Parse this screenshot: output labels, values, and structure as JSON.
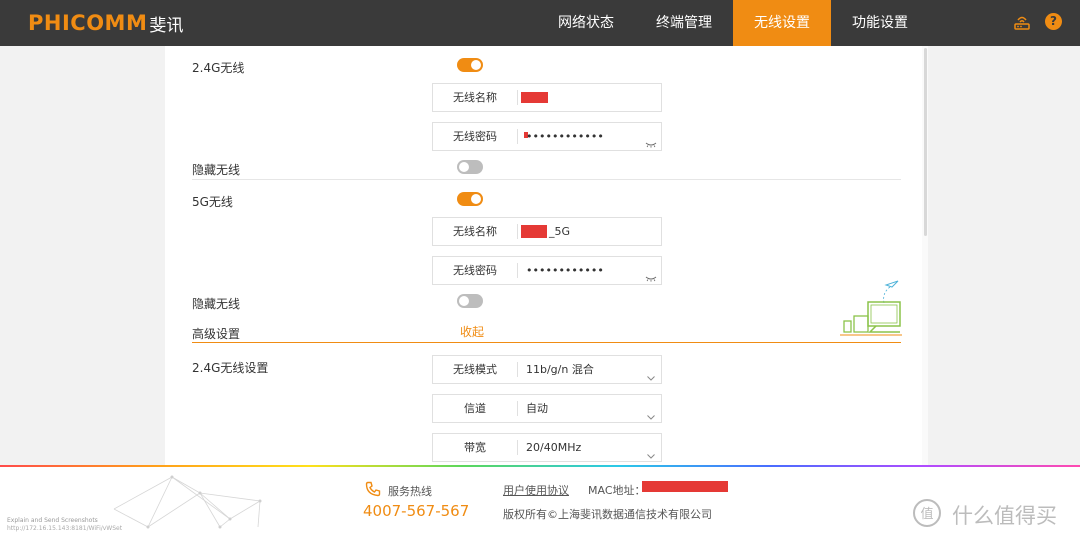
{
  "header": {
    "brand": "PHICOMM",
    "brand_cn": "斐讯",
    "nav": [
      {
        "label": "网络状态",
        "active": false
      },
      {
        "label": "终端管理",
        "active": false
      },
      {
        "label": "无线设置",
        "active": true
      },
      {
        "label": "功能设置",
        "active": false
      }
    ],
    "icons": [
      "router-icon",
      "help-icon"
    ],
    "help_glyph": "?"
  },
  "wireless_24g": {
    "label": "2.4G无线",
    "enabled": true,
    "ssid_label": "无线名称",
    "ssid_value": "",
    "password_label": "无线密码",
    "password_value": "••••••••••••",
    "hide_label": "隐藏无线",
    "hidden": false
  },
  "wireless_5g": {
    "label": "5G无线",
    "enabled": true,
    "ssid_label": "无线名称",
    "ssid_value": "_5G",
    "password_label": "无线密码",
    "password_value": "••••••••••••",
    "hide_label": "隐藏无线",
    "hidden": false
  },
  "advanced": {
    "label": "高级设置",
    "collapse_label": "收起",
    "section_24g_label": "2.4G无线设置",
    "mode_label": "无线模式",
    "mode_value": "11b/g/n 混合",
    "channel_label": "信道",
    "channel_value": "自动",
    "bandwidth_label": "带宽",
    "bandwidth_value": "20/40MHz"
  },
  "footer": {
    "hotline_label": "服务热线",
    "hotline_number": "4007-567-567",
    "agreement_link": "用户使用协议",
    "mac_label": "MAC地址：",
    "copyright": "版权所有©上海斐讯数据通信技术有限公司",
    "tiny_line1": "Explain and Send Screenshots",
    "tiny_line2": "http://172.16.15.143:8181/WiFi/vWSet",
    "watermark_text": "什么值得买",
    "watermark_glyph": "值"
  },
  "colors": {
    "accent": "#f08c13",
    "header_bg": "#3a3a3a",
    "redaction": "#e53935",
    "toggle_off": "#bdbdbd"
  }
}
